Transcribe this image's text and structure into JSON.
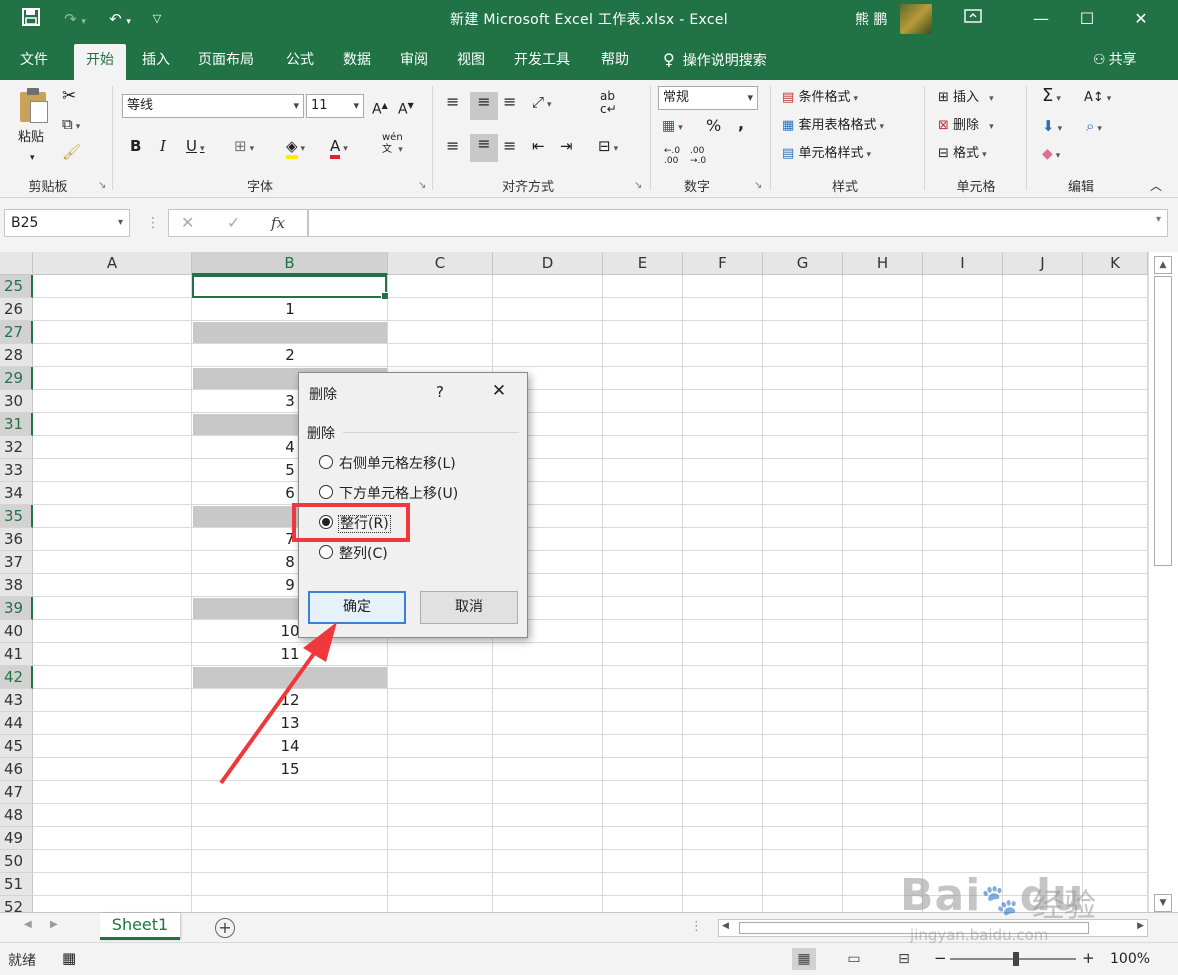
{
  "window": {
    "title": "新建 Microsoft Excel 工作表.xlsx  -  Excel",
    "user": "熊 鹏",
    "accent": "#217346"
  },
  "quick_access": {
    "save_icon": "save-icon",
    "redo_icon": "redo-icon",
    "undo_icon": "undo-icon",
    "customize_icon": "chevron-down-icon"
  },
  "tabs": [
    "文件",
    "开始",
    "插入",
    "页面布局",
    "公式",
    "数据",
    "审阅",
    "视图",
    "开发工具",
    "帮助"
  ],
  "active_tab": "开始",
  "tell_me": "操作说明搜索",
  "share": "共享",
  "ribbon": {
    "clipboard": {
      "paste": "粘贴",
      "label": "剪贴板"
    },
    "font": {
      "name": "等线",
      "size": "11",
      "bold": "B",
      "italic": "I",
      "underline": "U",
      "label": "字体"
    },
    "alignment": {
      "label": "对齐方式"
    },
    "number": {
      "format": "常规",
      "percent": "%",
      "comma": ",",
      "label": "数字"
    },
    "styles": {
      "conditional": "条件格式",
      "table": "套用表格格式",
      "cell_styles": "单元格样式",
      "label": "样式"
    },
    "cells": {
      "insert": "插入",
      "delete": "删除",
      "format": "格式",
      "label": "单元格"
    },
    "editing": {
      "label": "编辑"
    }
  },
  "formula_bar": {
    "name_box": "B25",
    "fx": "fx",
    "value": ""
  },
  "grid": {
    "columns": [
      "A",
      "B",
      "C",
      "D",
      "E",
      "F",
      "G",
      "H",
      "I",
      "J",
      "K"
    ],
    "selected_column": "B",
    "rows": [
      "25",
      "26",
      "27",
      "28",
      "29",
      "30",
      "31",
      "32",
      "33",
      "34",
      "35",
      "36",
      "37",
      "38",
      "39",
      "40",
      "41",
      "42",
      "43",
      "44",
      "45",
      "46",
      "47",
      "48",
      "49",
      "50",
      "51",
      "52"
    ],
    "selected_rows": [
      "25",
      "27",
      "29",
      "31",
      "35",
      "39",
      "42"
    ],
    "column_b_values": [
      "",
      "1",
      "",
      "2",
      "",
      "3",
      "",
      "4",
      "5",
      "6",
      "",
      "7",
      "8",
      "9",
      "",
      "10",
      "11",
      "",
      "12",
      "13",
      "14",
      "15",
      "",
      "",
      "",
      "",
      "",
      ""
    ]
  },
  "dialog": {
    "title": "删除",
    "help": "?",
    "group_label": "删除",
    "options": [
      {
        "label": "右侧单元格左移(L)",
        "checked": false
      },
      {
        "label": "下方单元格上移(U)",
        "checked": false
      },
      {
        "label": "整行(R)",
        "checked": true
      },
      {
        "label": "整列(C)",
        "checked": false
      }
    ],
    "ok": "确定",
    "cancel": "取消"
  },
  "sheets": [
    "Sheet1"
  ],
  "status": {
    "ready": "就绪",
    "zoom": "100%"
  },
  "watermark": {
    "brand": "Baidu经验",
    "url": "jingyan.baidu.com"
  }
}
